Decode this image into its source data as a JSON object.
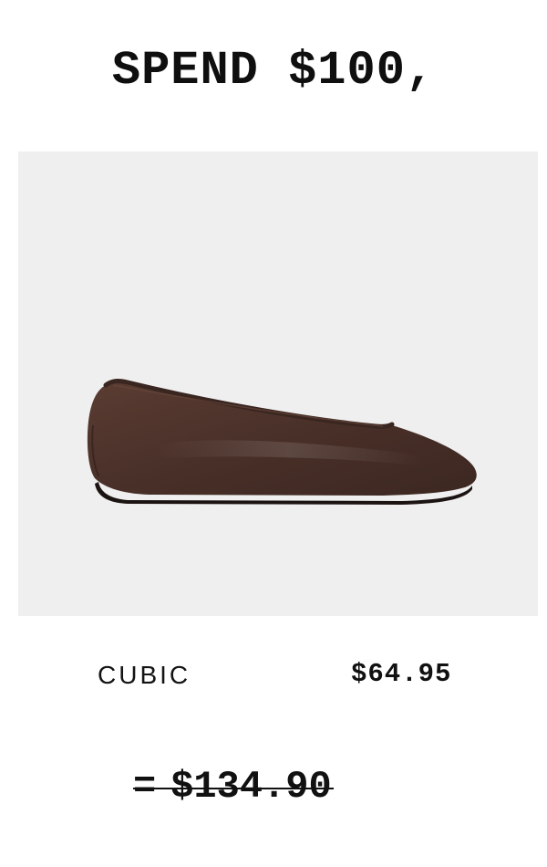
{
  "headline": {
    "text": "SPEND $100,"
  },
  "product": {
    "image_alt": "brown leather ballet flat",
    "name": "CUBIC",
    "price": "$64.95",
    "image_background": "#efefef",
    "leather_color": "#4a3129"
  },
  "total": {
    "equals": "=",
    "original_price": "$134.90"
  }
}
